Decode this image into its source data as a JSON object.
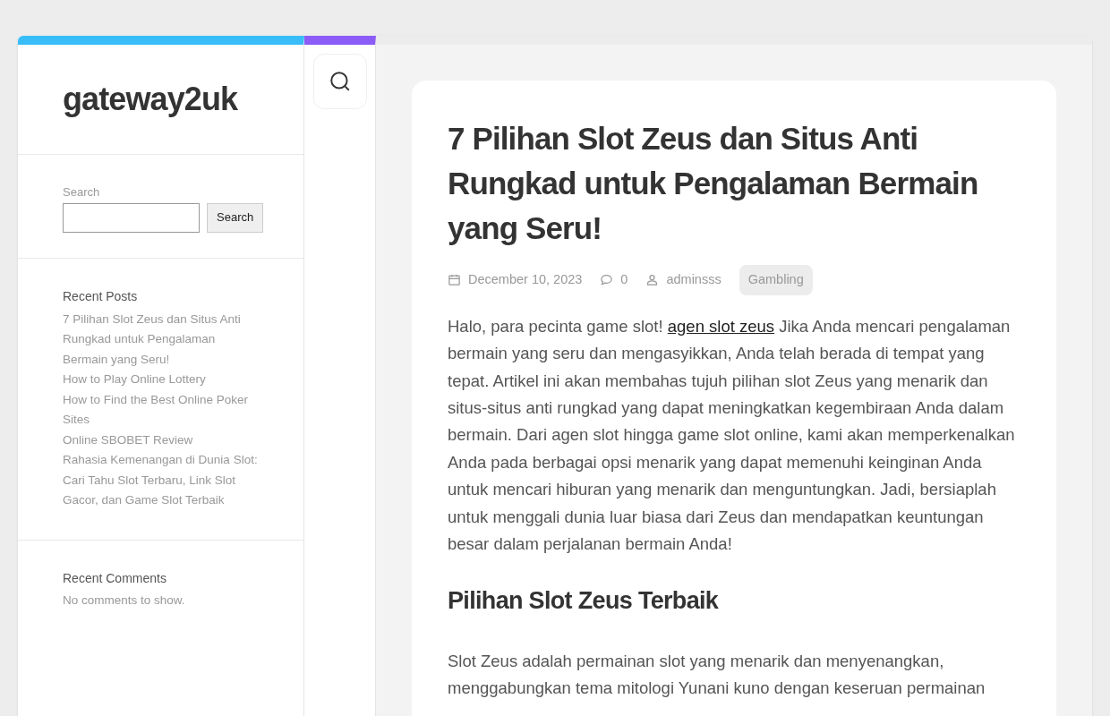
{
  "site": {
    "title": "gateway2uk"
  },
  "search_widget": {
    "label": "Search",
    "button": "Search"
  },
  "recent_posts": {
    "heading": "Recent Posts",
    "items": [
      "7 Pilihan Slot Zeus dan Situs Anti Rungkad untuk Pengalaman Bermain yang Seru!",
      "How to Play Online Lottery",
      "How to Find the Best Online Poker Sites",
      "Online SBOBET Review",
      "Rahasia Kemenangan di Dunia Slot: Cari Tahu Slot Terbaru, Link Slot Gacor, dan Game Slot Terbaik"
    ]
  },
  "recent_comments": {
    "heading": "Recent Comments",
    "text": "No comments to show."
  },
  "article": {
    "title": "7 Pilihan Slot Zeus dan Situs Anti Rungkad untuk Pengalaman Bermain yang Seru!",
    "meta": {
      "date": "December 10, 2023",
      "comments": "0",
      "author": "adminsss",
      "category": "Gambling"
    },
    "intro": {
      "before": "Halo, para pecinta game slot!",
      "link": "agen slot zeus",
      "after": "Jika Anda mencari pengalaman bermain yang seru dan mengasyikkan, Anda telah berada di tempat yang tepat. Artikel ini akan membahas tujuh pilihan slot Zeus yang menarik dan situs-situs anti rungkad yang dapat meningkatkan kegembiraan Anda dalam bermain. Dari agen slot hingga game slot online, kami akan memperkenalkan Anda pada berbagai opsi menarik yang dapat memenuhi keinginan Anda untuk mencari hiburan yang menarik dan menguntungkan. Jadi, bersiaplah untuk menggali dunia luar biasa dari Zeus dan mendapatkan keuntungan besar dalam perjalanan bermain Anda!"
    },
    "subheading": "Pilihan Slot Zeus Terbaik",
    "paragraph": "Slot Zeus adalah permainan slot yang menarik dan menyenangkan, menggabungkan tema mitologi Yunani kuno dengan keseruan permainan"
  }
}
